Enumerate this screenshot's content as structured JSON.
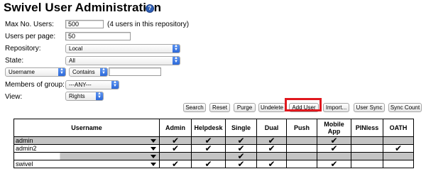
{
  "header": {
    "title": "Swivel User Administration",
    "help_icon": "help-icon"
  },
  "form": {
    "max_users_label": "Max No. Users:",
    "max_users_value": "500",
    "users_note": "(4 users in this repository)",
    "per_page_label": "Users per page:",
    "per_page_value": "50",
    "repository_label": "Repository:",
    "repository_value": "Local",
    "state_label": "State:",
    "state_value": "All",
    "filter_field_value": "Username",
    "filter_op_value": "Contains",
    "filter_text_value": "",
    "group_label": "Members of group:",
    "group_value": "---ANY---",
    "view_label": "View:",
    "view_value": "Rights"
  },
  "buttons": {
    "search": "Search",
    "reset": "Reset",
    "purge": "Purge",
    "undelete": "Undelete",
    "add_user": "Add User",
    "import": "Import...",
    "user_sync": "User Sync",
    "sync_count": "Sync Count"
  },
  "highlight_color": "#e0181e",
  "table": {
    "columns": [
      "Username",
      "Admin",
      "Helpdesk",
      "Single",
      "Dual",
      "Push",
      "Mobile App",
      "PINless",
      "OATH"
    ],
    "check_glyph": "✔",
    "rows": [
      {
        "username": "admin",
        "admin": "✔",
        "helpdesk": "✔",
        "single": "✔",
        "dual": "✔",
        "push": "",
        "mobile_app": "✔",
        "pinless": "",
        "oath": ""
      },
      {
        "username": "admin2",
        "admin": "✔",
        "helpdesk": "✔",
        "single": "✔",
        "dual": "✔",
        "push": "",
        "mobile_app": "✔",
        "pinless": "",
        "oath": "✔"
      },
      {
        "username": "",
        "admin": "",
        "helpdesk": "",
        "single": "✔",
        "dual": "",
        "push": "",
        "mobile_app": "",
        "pinless": "",
        "oath": ""
      },
      {
        "username": "swivel",
        "admin": "✔",
        "helpdesk": "✔",
        "single": "✔",
        "dual": "✔",
        "push": "",
        "mobile_app": "✔",
        "pinless": "",
        "oath": ""
      }
    ]
  }
}
